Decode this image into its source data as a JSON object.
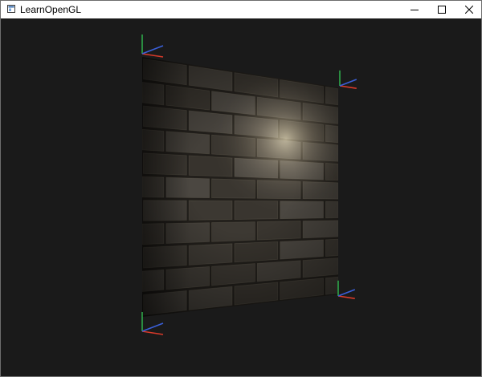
{
  "window": {
    "title": "LearnOpenGL",
    "icon": "app-window-icon",
    "controls": {
      "minimize_icon": "minimize-icon",
      "maximize_icon": "maximize-icon",
      "close_icon": "close-icon"
    }
  },
  "viewport": {
    "background_color": "#1a1a1a",
    "content": "normal-mapped-brick-wall",
    "axis_gizmo_colors": {
      "x": "#d83a2a",
      "y": "#2fa84a",
      "z": "#3a5fd8"
    }
  }
}
